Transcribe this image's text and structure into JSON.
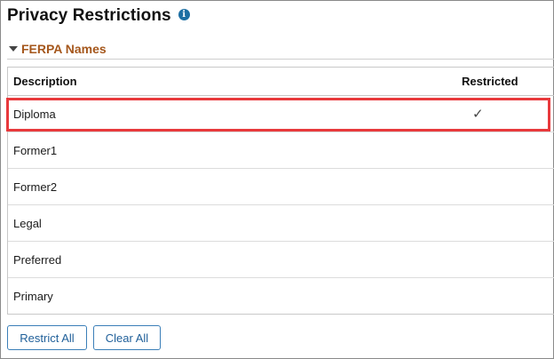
{
  "page": {
    "title": "Privacy Restrictions",
    "info_icon": "info-icon"
  },
  "section": {
    "title": "FERPA Names",
    "expanded": true
  },
  "table": {
    "columns": [
      "Description",
      "Restricted"
    ],
    "rows": [
      {
        "description": "Diploma",
        "restricted": true,
        "restricted_mark": "✓"
      },
      {
        "description": "Former1",
        "restricted": false,
        "restricted_mark": ""
      },
      {
        "description": "Former2",
        "restricted": false,
        "restricted_mark": ""
      },
      {
        "description": "Legal",
        "restricted": false,
        "restricted_mark": ""
      },
      {
        "description": "Preferred",
        "restricted": false,
        "restricted_mark": ""
      },
      {
        "description": "Primary",
        "restricted": false,
        "restricted_mark": ""
      }
    ],
    "highlighted_row": "Diploma"
  },
  "buttons": {
    "restrict_all": "Restrict All",
    "clear_all": "Clear All"
  },
  "colors": {
    "section_title": "#a5571c",
    "info_icon": "#1d6fa3",
    "button_border": "#3b7fb8",
    "highlight": "#e8393c"
  }
}
